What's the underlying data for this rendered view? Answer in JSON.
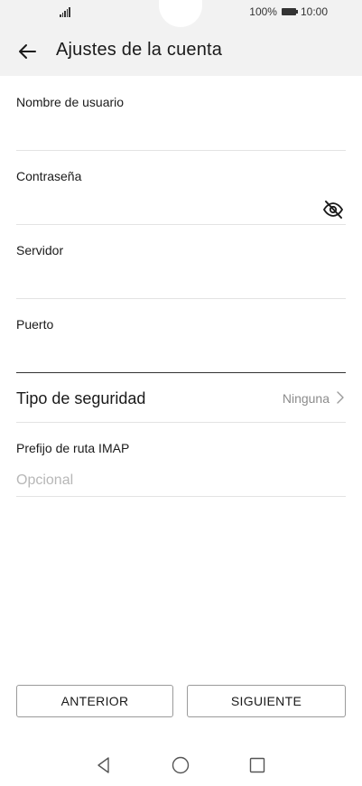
{
  "status_bar": {
    "battery_text": "100%",
    "time": "10:00"
  },
  "header": {
    "title": "Ajustes de la cuenta"
  },
  "fields": {
    "username": {
      "label": "Nombre de usuario",
      "value": ""
    },
    "password": {
      "label": "Contraseña",
      "value": ""
    },
    "server": {
      "label": "Servidor",
      "value": ""
    },
    "port": {
      "label": "Puerto",
      "value": ""
    },
    "imap_prefix": {
      "label": "Prefijo de ruta IMAP",
      "placeholder": "Opcional",
      "value": ""
    }
  },
  "security": {
    "label": "Tipo de seguridad",
    "value": "Ninguna"
  },
  "buttons": {
    "previous": "ANTERIOR",
    "next": "SIGUIENTE"
  },
  "icons": {
    "back": "back-arrow-icon",
    "visibility": "eye-off-icon",
    "chevron": "chevron-right-icon",
    "nav_back": "triangle-back-icon",
    "nav_home": "circle-home-icon",
    "nav_recents": "square-recents-icon"
  }
}
